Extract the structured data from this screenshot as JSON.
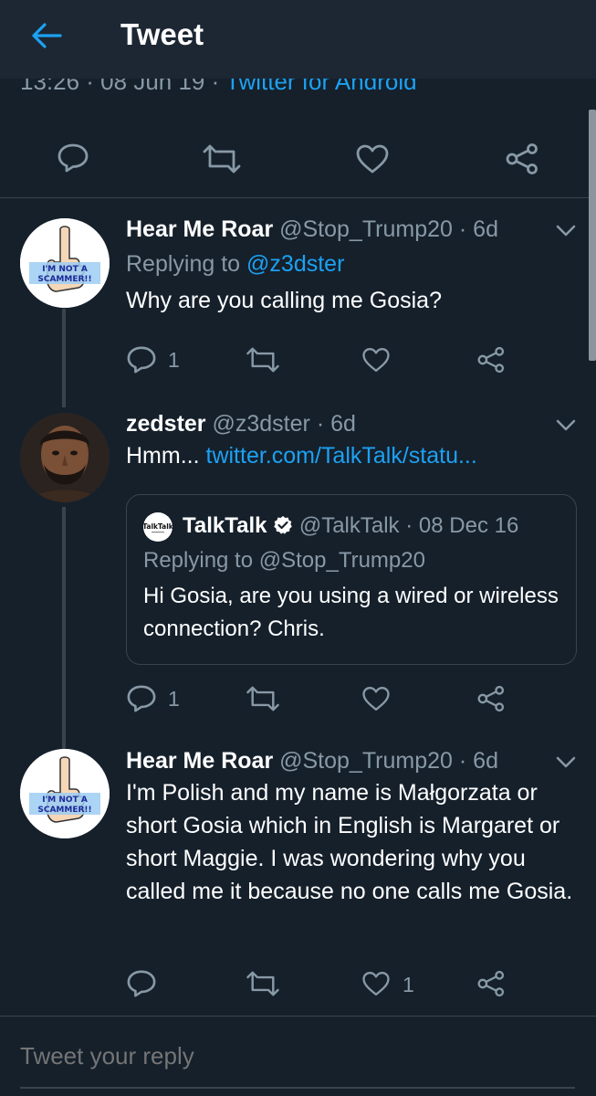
{
  "header": {
    "title": "Tweet"
  },
  "main_tweet": {
    "timestamp": "13:26 · 08 Jun 19 · ",
    "source": "Twitter for Android"
  },
  "tweets": [
    {
      "name": "Hear Me Roar",
      "handle": "@Stop_Trump20",
      "time": "· 6d",
      "replying_label": "Replying to",
      "replying_to": "@z3dster",
      "text": "Why are you calling me Gosia?",
      "reply_count": "1",
      "retweet_count": "",
      "like_count": "",
      "avatar_text": "I'M NOT A SCAMMER!!"
    },
    {
      "name": "zedster",
      "handle": "@z3dster",
      "time": "· 6d",
      "text_prefix": "Hmm... ",
      "link": "twitter.com/TalkTalk/statu...",
      "reply_count": "1",
      "quote": {
        "logo_text": "TalkTalk",
        "name": "TalkTalk",
        "handle": "@TalkTalk",
        "time": "· 08 Dec 16",
        "replying": "Replying to @Stop_Trump20",
        "text": "Hi Gosia, are you using a wired or wireless connection? Chris."
      }
    },
    {
      "name": "Hear Me Roar",
      "handle": "@Stop_Trump20",
      "time": "· 6d",
      "text": "I'm Polish and my name is Małgorzata or short Gosia which in English is Margaret or short Maggie. I was wondering why you called me it because no one calls me Gosia.",
      "like_count": "1",
      "avatar_text": "I'M NOT A SCAMMER!!"
    }
  ],
  "reply_box": {
    "placeholder": "Tweet your reply"
  },
  "colors": {
    "background": "#15202b",
    "header": "#1c2733",
    "accent": "#1da1f2",
    "secondary_text": "#8899a6",
    "border": "#38444d"
  },
  "icons": [
    "back-arrow-icon",
    "reply-icon",
    "retweet-icon",
    "like-icon",
    "share-icon",
    "chevron-down-icon",
    "verified-badge-icon"
  ]
}
